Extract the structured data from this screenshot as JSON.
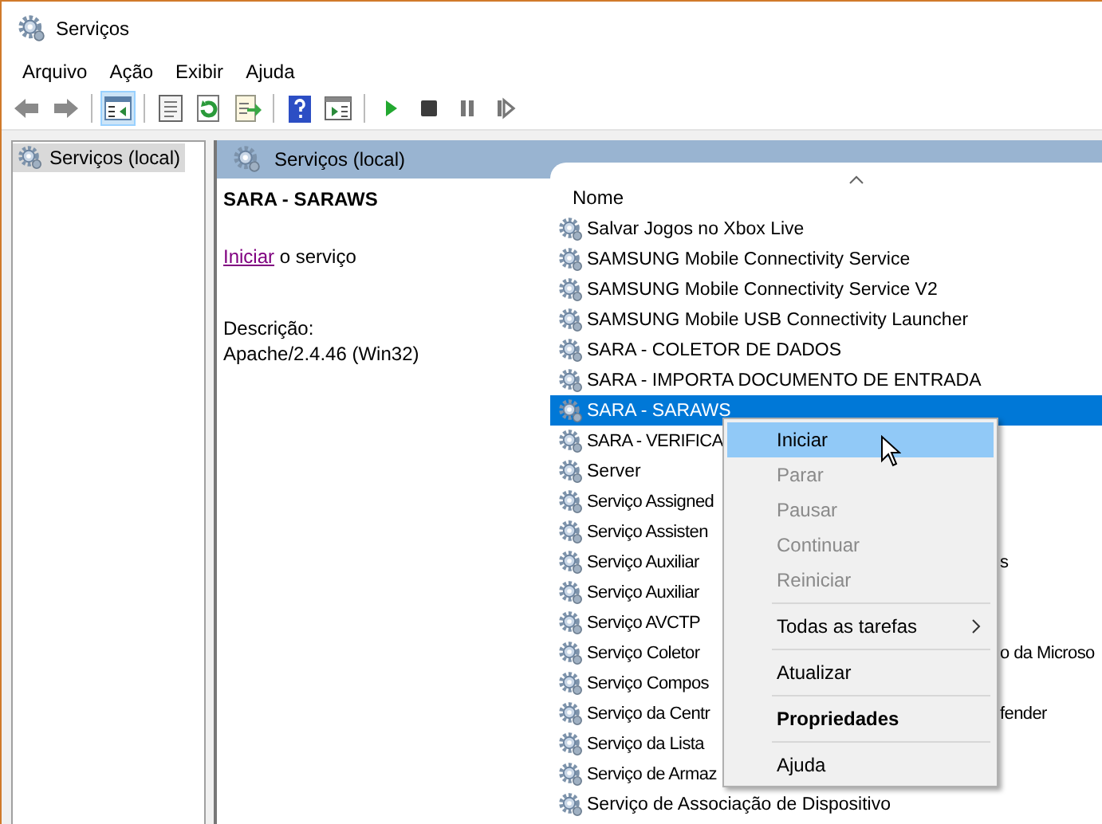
{
  "window": {
    "title": "Serviços"
  },
  "menu_bar": [
    "Arquivo",
    "Ação",
    "Exibir",
    "Ajuda"
  ],
  "toolbar": [
    {
      "kind": "back",
      "pressed": false
    },
    {
      "kind": "forward",
      "pressed": false
    },
    {
      "kind": "separator"
    },
    {
      "kind": "tree",
      "pressed": true
    },
    {
      "kind": "separator"
    },
    {
      "kind": "properties",
      "pressed": false
    },
    {
      "kind": "refresh",
      "pressed": false
    },
    {
      "kind": "export",
      "pressed": false
    },
    {
      "kind": "separator"
    },
    {
      "kind": "help",
      "pressed": false
    },
    {
      "kind": "view",
      "pressed": false
    },
    {
      "kind": "separator"
    },
    {
      "kind": "play",
      "pressed": false
    },
    {
      "kind": "stop",
      "pressed": false
    },
    {
      "kind": "pause",
      "pressed": false
    },
    {
      "kind": "resume",
      "pressed": false
    }
  ],
  "tree": {
    "items": [
      {
        "label": "Serviços (local)",
        "selected": true
      }
    ]
  },
  "pane": {
    "title": "Serviços (local)",
    "detail": {
      "service_name": "SARA - SARAWS",
      "action_link": "Iniciar",
      "action_text": "o serviço",
      "description_label": "Descrição:",
      "description": "Apache/2.4.46 (Win32)"
    },
    "list": {
      "column": "Nome",
      "rows": [
        {
          "name": "Salvar Jogos no Xbox Live",
          "selected": false
        },
        {
          "name": "SAMSUNG Mobile Connectivity Service",
          "selected": false
        },
        {
          "name": "SAMSUNG Mobile Connectivity Service V2",
          "selected": false
        },
        {
          "name": "SAMSUNG Mobile USB Connectivity Launcher",
          "selected": false
        },
        {
          "name": "SARA - COLETOR DE DADOS",
          "selected": false
        },
        {
          "name": "SARA - IMPORTA DOCUMENTO DE ENTRADA",
          "selected": false
        },
        {
          "name": "SARA - SARAWS",
          "selected": true
        },
        {
          "name": "SARA - VERIFICA",
          "short": true,
          "selected": false
        },
        {
          "name": "Server",
          "selected": false
        },
        {
          "name": "Serviço Assigned",
          "short": true,
          "selected": false
        },
        {
          "name": "Serviço Assisten",
          "short": true,
          "selected": false
        },
        {
          "name": "Serviço Auxiliar",
          "tail": "s",
          "selected": false
        },
        {
          "name": "Serviço Auxiliar",
          "short": true,
          "selected": false
        },
        {
          "name": "Serviço AVCTP",
          "short": true,
          "selected": false
        },
        {
          "name": "Serviço Coletor",
          "tail": "o da Microso",
          "selected": false
        },
        {
          "name": "Serviço Compos",
          "short": true,
          "selected": false
        },
        {
          "name": "Serviço da Centr",
          "tail": "fender",
          "selected": false
        },
        {
          "name": "Serviço da Lista",
          "short": true,
          "selected": false
        },
        {
          "name": "Serviço de Armaz",
          "short": true,
          "selected": false
        },
        {
          "name": "Serviço de Associação de Dispositivo",
          "selected": false
        }
      ]
    }
  },
  "context_menu": [
    {
      "kind": "item",
      "label": "Iniciar",
      "selected": true,
      "disabled": false
    },
    {
      "kind": "item",
      "label": "Parar",
      "selected": false,
      "disabled": true
    },
    {
      "kind": "item",
      "label": "Pausar",
      "selected": false,
      "disabled": true
    },
    {
      "kind": "item",
      "label": "Continuar",
      "selected": false,
      "disabled": true
    },
    {
      "kind": "item",
      "label": "Reiniciar",
      "selected": false,
      "disabled": true
    },
    {
      "kind": "separator"
    },
    {
      "kind": "item",
      "label": "Todas as tarefas",
      "selected": false,
      "disabled": false,
      "submenu": true
    },
    {
      "kind": "separator"
    },
    {
      "kind": "item",
      "label": "Atualizar",
      "selected": false,
      "disabled": false
    },
    {
      "kind": "separator"
    },
    {
      "kind": "item",
      "label": "Propriedades",
      "selected": false,
      "disabled": false,
      "default": true
    },
    {
      "kind": "separator"
    },
    {
      "kind": "item",
      "label": "Ajuda",
      "selected": false,
      "disabled": false
    }
  ]
}
